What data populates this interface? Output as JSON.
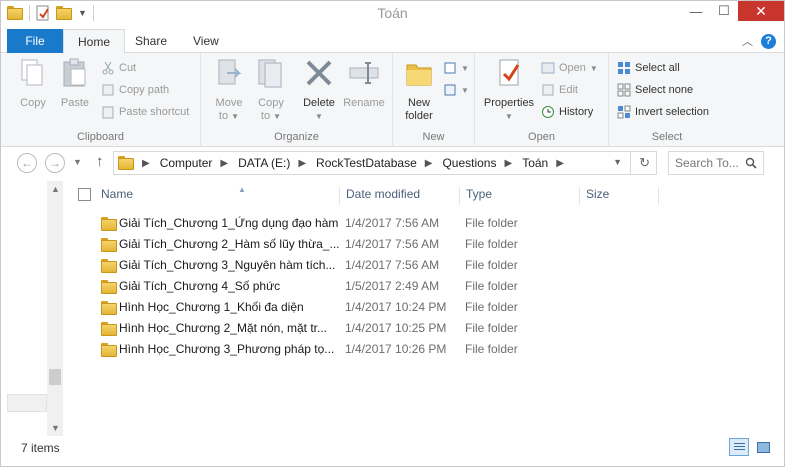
{
  "window": {
    "title": "Toán"
  },
  "ribbon_tabs": {
    "file": "File",
    "home": "Home",
    "share": "Share",
    "view": "View"
  },
  "clipboard": {
    "group": "Clipboard",
    "copy": "Copy",
    "paste": "Paste",
    "cut": "Cut",
    "copy_path": "Copy path",
    "paste_shortcut": "Paste shortcut"
  },
  "organize": {
    "group": "Organize",
    "move_to_1": "Move",
    "move_to_2": "to",
    "copy_to_1": "Copy",
    "copy_to_2": "to",
    "delete": "Delete",
    "rename": "Rename"
  },
  "new_group": {
    "group": "New",
    "new_folder_1": "New",
    "new_folder_2": "folder"
  },
  "open_group": {
    "group": "Open",
    "properties": "Properties",
    "open": "Open",
    "edit": "Edit",
    "history": "History"
  },
  "select_group": {
    "group": "Select",
    "select_all": "Select all",
    "select_none": "Select none",
    "invert": "Invert selection"
  },
  "address": {
    "crumbs": [
      "Computer",
      "DATA (E:)",
      "RockTestDatabase",
      "Questions",
      "Toán"
    ]
  },
  "search": {
    "placeholder": "Search To..."
  },
  "columns": {
    "name": "Name",
    "date": "Date modified",
    "type": "Type",
    "size": "Size"
  },
  "files": [
    {
      "name": "Giải Tích_Chương 1_Ứng dụng đạo hàm",
      "date": "1/4/2017 7:56 AM",
      "type": "File folder"
    },
    {
      "name": "Giải Tích_Chương 2_Hàm số lũy thừa_...",
      "date": "1/4/2017 7:56 AM",
      "type": "File folder"
    },
    {
      "name": "Giải Tích_Chương 3_Nguyên hàm tích...",
      "date": "1/4/2017 7:56 AM",
      "type": "File folder"
    },
    {
      "name": "Giải Tích_Chương 4_Số phức",
      "date": "1/5/2017 2:49 AM",
      "type": "File folder"
    },
    {
      "name": "Hình Học_Chương 1_Khối đa diện",
      "date": "1/4/2017 10:24 PM",
      "type": "File folder"
    },
    {
      "name": "Hình Học_Chương 2_Mặt nón, mặt tr...",
      "date": "1/4/2017 10:25 PM",
      "type": "File folder"
    },
    {
      "name": "Hình Học_Chương 3_Phương pháp tọ...",
      "date": "1/4/2017 10:26 PM",
      "type": "File folder"
    }
  ],
  "status": {
    "count": "7 items"
  }
}
